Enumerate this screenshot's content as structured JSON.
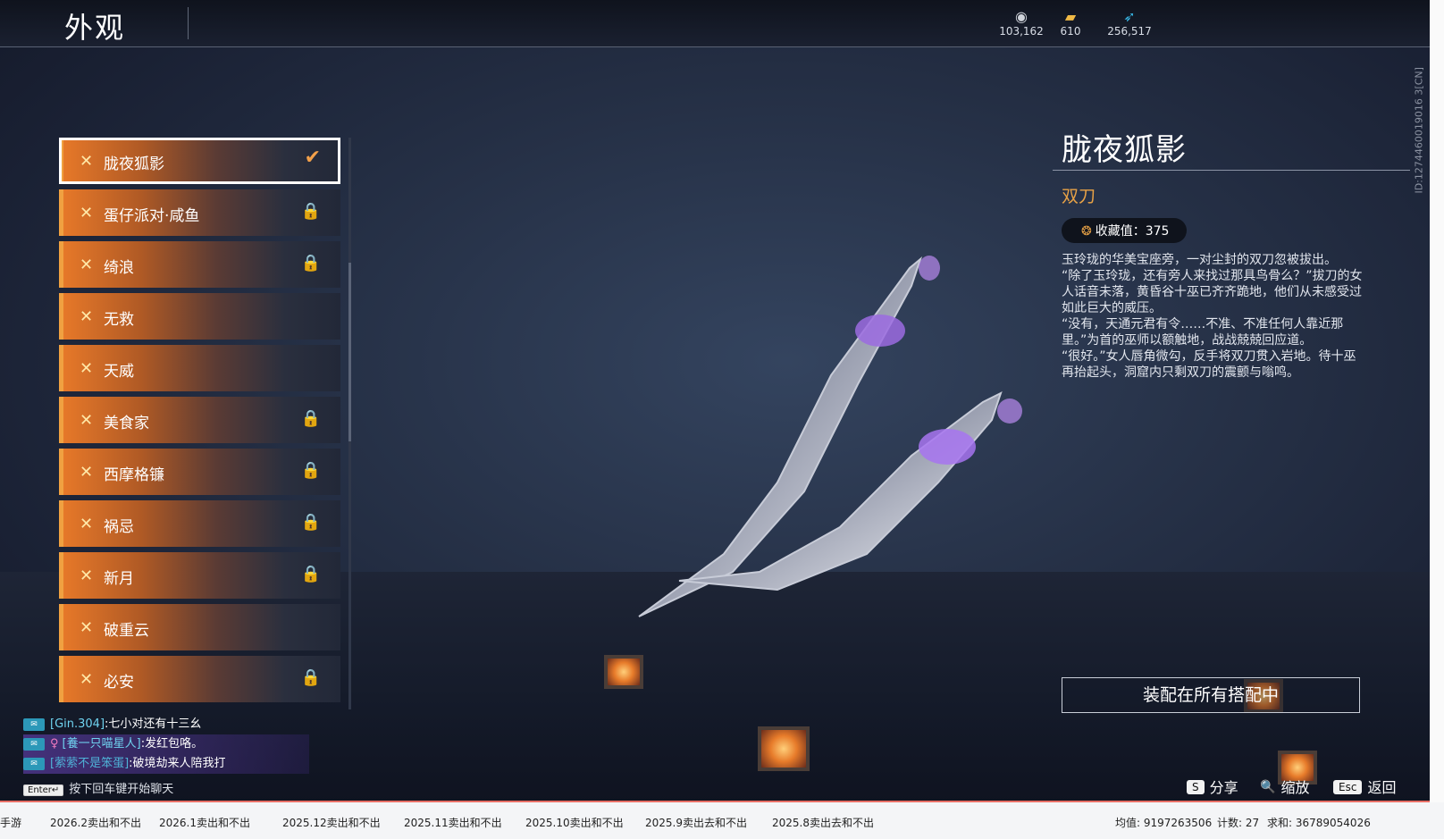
{
  "header": {
    "title": "外观",
    "currencies": [
      {
        "icon": "coin-icon",
        "value": "103,162"
      },
      {
        "icon": "gold-ticket-icon",
        "value": "610"
      },
      {
        "icon": "feather-icon",
        "value": "256,517"
      }
    ]
  },
  "id_tag": "ID:1274460019016 3[CN]",
  "skins": [
    {
      "name": "胧夜狐影",
      "status": "selected"
    },
    {
      "name": "蛋仔派对·咸鱼",
      "status": "locked"
    },
    {
      "name": "绮浪",
      "status": "locked"
    },
    {
      "name": "无救",
      "status": ""
    },
    {
      "name": "天威",
      "status": ""
    },
    {
      "name": "美食家",
      "status": "locked"
    },
    {
      "name": "西摩格镰",
      "status": "locked"
    },
    {
      "name": "祸忌",
      "status": "locked"
    },
    {
      "name": "新月",
      "status": "locked"
    },
    {
      "name": "破重云",
      "status": ""
    },
    {
      "name": "必安",
      "status": "locked"
    }
  ],
  "details": {
    "name": "胧夜狐影",
    "type": "双刀",
    "collect_label": "收藏值：375",
    "description": [
      "玉玲珑的华美宝座旁，一对尘封的双刀忽被拔出。",
      "“除了玉玲珑，还有旁人来找过那具鸟骨么？”拔刀的女人话音未落，黄昏谷十巫已齐齐跪地，他们从未感受过如此巨大的威压。",
      "“没有，天通元君有令……不准、不准任何人靠近那里。”为首的巫师以额触地，战战兢兢回应道。",
      "“很好。”女人唇角微勾，反手将双刀贯入岩地。待十巫再抬起头，洞窟内只剩双刀的震颤与嗡鸣。"
    ],
    "equip_label": "装配在所有搭配中"
  },
  "chat": [
    {
      "channel_icon": "chat-channel-icon",
      "who": "[Gin.304]",
      "text": ":七小对还有十三幺"
    },
    {
      "channel_icon": "chat-channel-icon",
      "who": "[養一只喵星人]",
      "text": ":发红包咯。"
    },
    {
      "channel_icon": "chat-channel-icon",
      "who": "[萦萦不是笨蛋]",
      "text": ":破境劫来人陪我打"
    }
  ],
  "enter_hint": {
    "key": "Enter↵",
    "text": "按下回车键开始聊天"
  },
  "hints": [
    {
      "key": "S",
      "label": "分享"
    },
    {
      "key": "🔍",
      "label": "缩放"
    },
    {
      "key": "Esc",
      "label": "返回"
    }
  ],
  "taskbar": {
    "tabs": [
      "手游",
      "2026.2卖出和不出",
      "2026.1卖出和不出",
      "2025.12卖出和不出",
      "2025.11卖出和不出",
      "2025.10卖出和不出",
      "2025.9卖出去和不出",
      "2025.8卖出去和不出"
    ],
    "avg": "均值: 9197263506",
    "count": "计数: 27",
    "sum": "求和: 36789054026"
  },
  "colors": {
    "accent": "#e8a246",
    "list_edge": "#f0a141"
  }
}
